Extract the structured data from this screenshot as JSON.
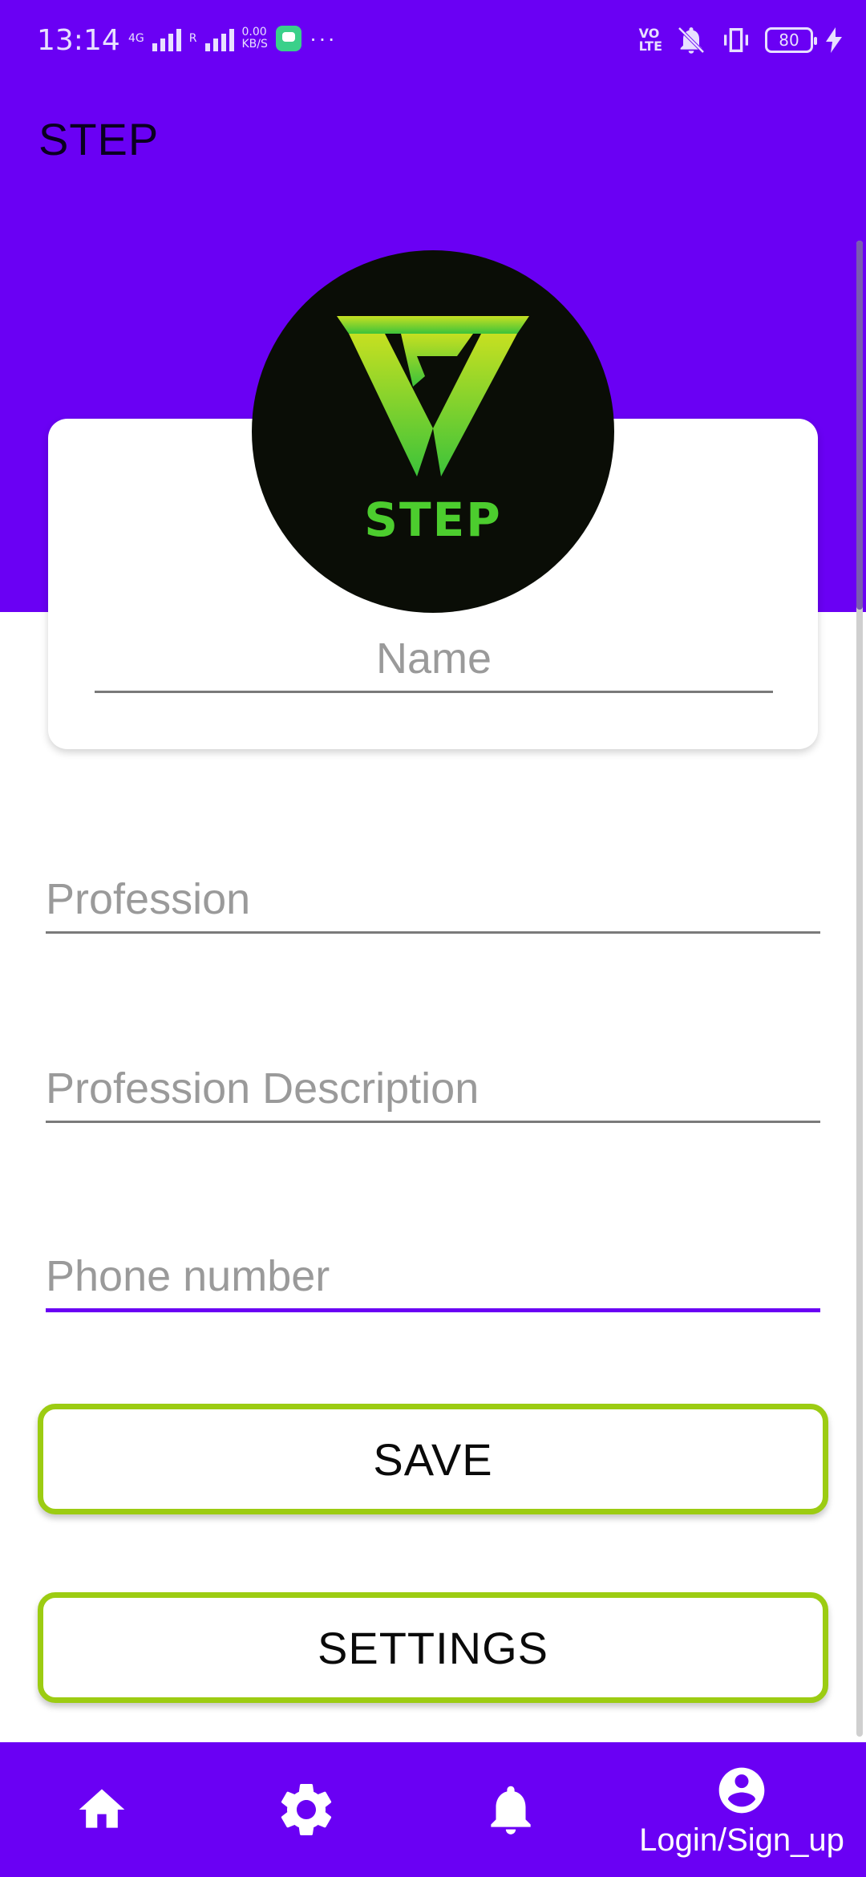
{
  "status_bar": {
    "time": "13:14",
    "network": "4G",
    "roaming": "R",
    "speed_value": "0.00",
    "speed_unit": "KB/S",
    "volte_top": "VO",
    "volte_bottom": "LTE",
    "battery": "80"
  },
  "app_bar": {
    "title": "STEP"
  },
  "profile": {
    "logo_text": "STEP",
    "name_placeholder": "Name"
  },
  "form": {
    "profession_placeholder": "Profession",
    "description_placeholder": "Profession Description",
    "phone_placeholder": "Phone number"
  },
  "buttons": {
    "save_label": "SAVE",
    "settings_label": "SETTINGS"
  },
  "bottom_nav": {
    "items": [
      {
        "icon": "home-icon"
      },
      {
        "icon": "gear-icon"
      },
      {
        "icon": "bell-icon"
      },
      {
        "icon": "account-icon",
        "label": "Login/Sign_up"
      }
    ]
  },
  "colors": {
    "primary": "#6a00f4",
    "button_border": "#9ccc12",
    "logo_green": "#4ccd2e"
  }
}
